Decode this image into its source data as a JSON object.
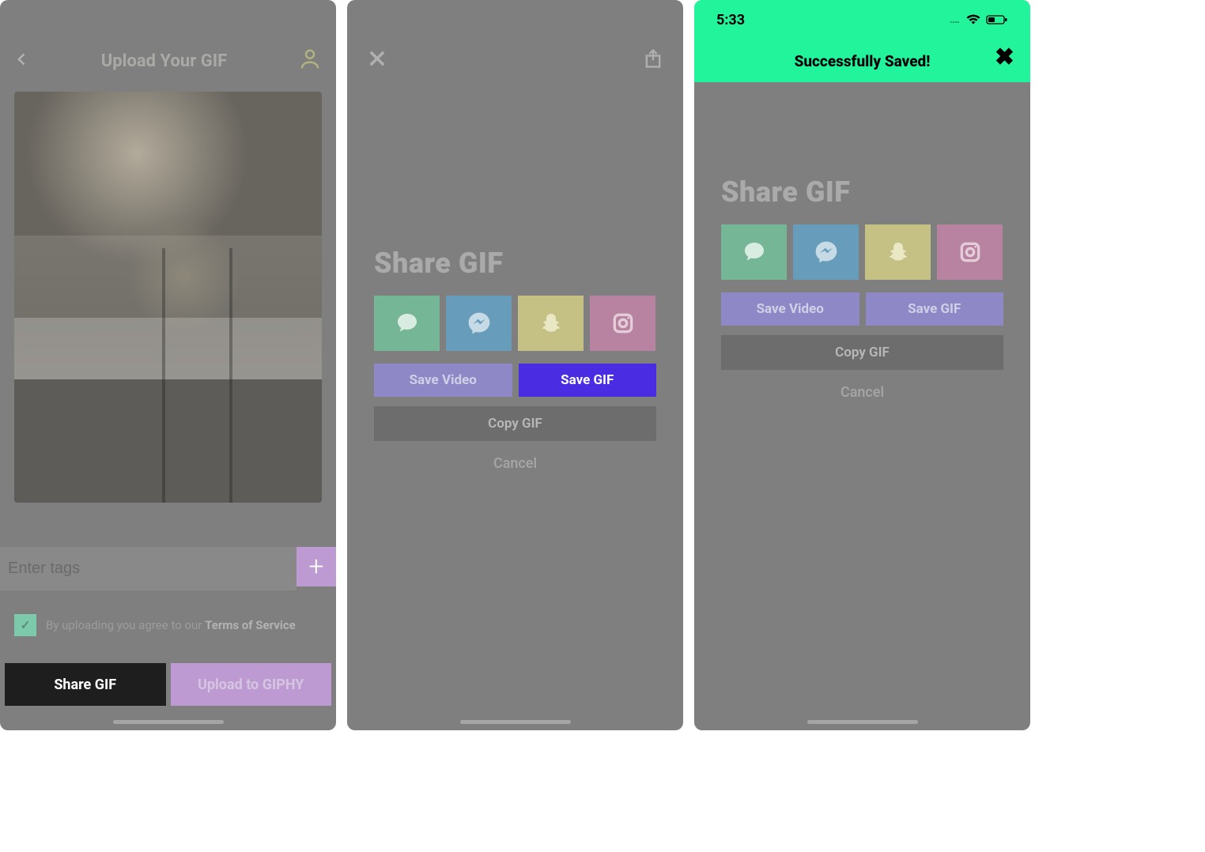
{
  "screen1": {
    "title": "Upload Your GIF",
    "tags_placeholder": "Enter tags",
    "terms_pre": "By uploading you agree to our ",
    "terms_link": "Terms of Service",
    "share_label": "Share GIF",
    "upload_label": "Upload to GIPHY"
  },
  "screen2": {
    "title": "Share GIF",
    "save_video": "Save Video",
    "save_gif": "Save GIF",
    "copy_gif": "Copy GIF",
    "cancel": "Cancel",
    "share_targets": [
      "messages",
      "messenger",
      "snapchat",
      "instagram"
    ]
  },
  "screen3": {
    "status_time": "5:33",
    "banner_text": "Successfully Saved!",
    "title": "Share GIF",
    "save_video": "Save Video",
    "save_gif": "Save GIF",
    "copy_gif": "Copy GIF",
    "cancel": "Cancel",
    "share_targets": [
      "messages",
      "messenger",
      "snapchat",
      "instagram"
    ]
  }
}
